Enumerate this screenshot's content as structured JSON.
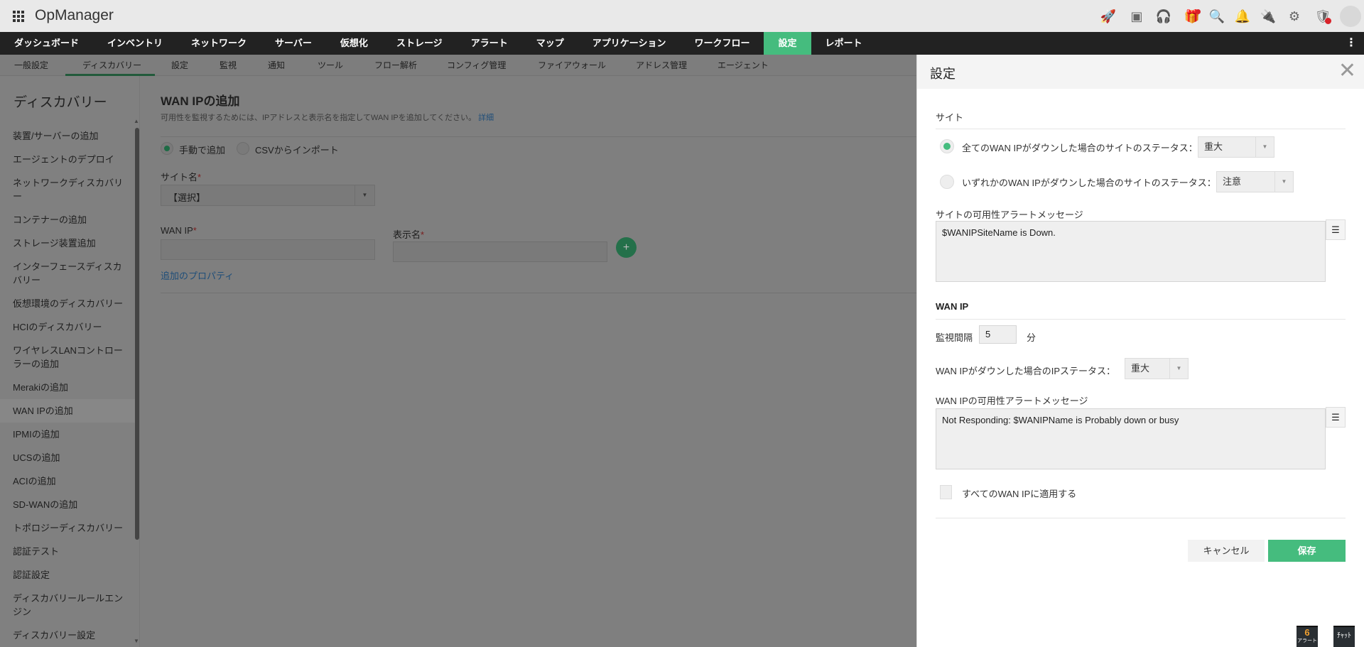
{
  "app": {
    "title": "OpManager"
  },
  "topbar_icons": [
    "rocket-icon",
    "presentation-icon",
    "headset-icon",
    "gift-icon",
    "search-icon",
    "bell-icon",
    "plug-icon",
    "gear-icon",
    "shield-alert-icon",
    "avatar-icon"
  ],
  "nav": {
    "items": [
      "ダッシュボード",
      "インベントリ",
      "ネットワーク",
      "サーバー",
      "仮想化",
      "ストレージ",
      "アラート",
      "マップ",
      "アプリケーション",
      "ワークフロー",
      "設定",
      "レポート"
    ],
    "active": "設定"
  },
  "subnav": {
    "items": [
      "一般設定",
      "ディスカバリー",
      "設定",
      "監視",
      "通知",
      "ツール",
      "フロー解析",
      "コンフィグ管理",
      "ファイアウォール",
      "アドレス管理",
      "エージェント"
    ],
    "active": "ディスカバリー"
  },
  "sidebar": {
    "title": "ディスカバリー",
    "items": [
      "装置/サーバーの追加",
      "エージェントのデプロイ",
      "ネットワークディスカバリー",
      "コンテナーの追加",
      "ストレージ装置追加",
      "インターフェースディスカバリー",
      "仮想環境のディスカバリー",
      "HCIのディスカバリー",
      "ワイヤレスLANコントローラーの追加",
      "Merakiの追加",
      "WAN IPの追加",
      "IPMIの追加",
      "UCSの追加",
      "ACIの追加",
      "SD-WANの追加",
      "トポロジーディスカバリー",
      "認証テスト",
      "認証設定",
      "ディスカバリールールエンジン",
      "ディスカバリー設定"
    ],
    "selected": "WAN IPの追加"
  },
  "main": {
    "title": "WAN IPの追加",
    "description": "可用性を監視するためには、IPアドレスと表示名を指定してWAN IPを追加してください。",
    "detail_link": "詳細",
    "radio_manual": "手動で追加",
    "radio_csv": "CSVからインポート",
    "site_label": "サイト名",
    "site_value": "【選択】",
    "wanip_label": "WAN IP",
    "display_label": "表示名",
    "required": "*",
    "add_props": "追加のプロパティ",
    "plus": "+"
  },
  "panel": {
    "title": "設定",
    "site_section": "サイト",
    "opt_all": "全てのWAN IPがダウンした場合のサイトのステータス：",
    "opt_all_value": "重大",
    "opt_any": "いずれかのWAN IPがダウンした場合のサイトのステータス：",
    "opt_any_value": "注意",
    "site_msg_label": "サイトの可用性アラートメッセージ",
    "site_msg": "$WANIPSiteName is Down.",
    "wanip_section": "WAN IP",
    "interval_label": "監視間隔",
    "interval_value": "5",
    "interval_unit": "分",
    "ip_status_label": "WAN IPがダウンした場合のIPステータス：",
    "ip_status_value": "重大",
    "ip_msg_label": "WAN IPの可用性アラートメッセージ",
    "ip_msg": "Not Responding: $WANIPName is Probably down or busy",
    "apply_all": "すべてのWAN IPに適用する",
    "cancel": "キャンセル",
    "save": "保存"
  },
  "footer": {
    "alert_count": "6",
    "alert_label": "アラート",
    "chat_label": "ﾁｬｯﾄ"
  },
  "colors": {
    "accent": "#45bc7e",
    "nav_bg": "#222222",
    "alert_dot": "#d8232a"
  }
}
